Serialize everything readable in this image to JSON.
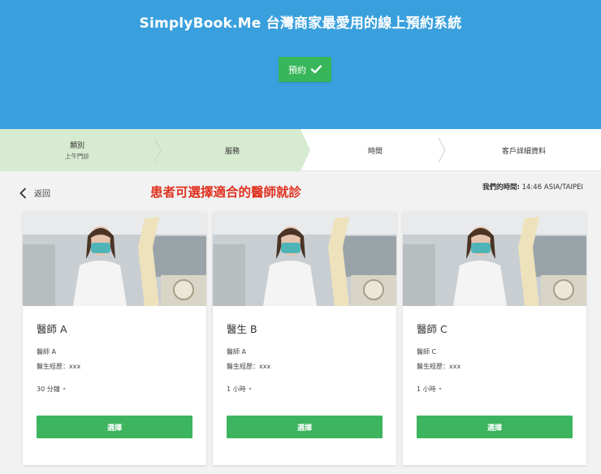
{
  "header": {
    "title": "SimplyBook.Me 台灣商家最愛用的線上預約系統",
    "book_button_label": "預約"
  },
  "steps": [
    {
      "label": "類別",
      "sub": "上午門診"
    },
    {
      "label": "服務",
      "sub": ""
    },
    {
      "label": "時間",
      "sub": ""
    },
    {
      "label": "客戶詳細資料",
      "sub": ""
    }
  ],
  "nav": {
    "back_label": "返回"
  },
  "annotation": "患者可選擇適合的醫師就診",
  "timezone": {
    "label": "我們的時間:",
    "value": " 14:46 ASIA/TAIPEI"
  },
  "cards": [
    {
      "name": "醫師 A",
      "line1": "醫師 A",
      "line2": "醫生經歷：xxx",
      "duration": "30 分鐘",
      "select_label": "選擇"
    },
    {
      "name": "醫生 B",
      "line1": "醫師 A",
      "line2": "醫生經歷：xxx",
      "duration": "1 小時",
      "select_label": "選擇"
    },
    {
      "name": "醫師 C",
      "line1": "醫師 C",
      "line2": "醫生經歷：xxx",
      "duration": "1 小時",
      "select_label": "選擇"
    }
  ],
  "colors": {
    "header_bg": "#3aa0dd",
    "primary_green": "#3cb55e",
    "done_step_bg": "#d7ebd1",
    "annotation_red": "#e0301e"
  }
}
